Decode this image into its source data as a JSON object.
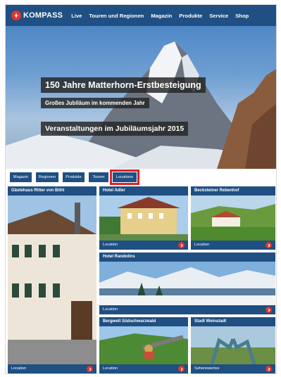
{
  "header": {
    "logo_text": "KOMPASS",
    "nav": [
      "Live",
      "Touren und Regionen",
      "Magazin",
      "Produkte",
      "Service",
      "Shop"
    ]
  },
  "hero": {
    "title": "150 Jahre Matterhorn-Erstbesteigung",
    "subtitle": "Großes Jubiläum im kommenden Jahr",
    "events": "Veranstaltungen im Jubiläumsjahr 2015"
  },
  "tabs": {
    "items": [
      "Magazin",
      "Regionen",
      "Produkte",
      "Touren",
      "Locations"
    ],
    "selected": "Locations"
  },
  "tiles": [
    {
      "title": "Gästehaus Ritter von Böhl",
      "footer": "Location"
    },
    {
      "title": "Hotel Adler",
      "footer": "Location"
    },
    {
      "title": "Becksteiner Rebenhof",
      "footer": "Location"
    },
    {
      "title": "Hotel Randolins",
      "footer": "Location"
    },
    {
      "title": "Bergwelt Südschwarzwald",
      "footer": "Location"
    },
    {
      "title": "Stadt Weinstadt",
      "footer": "Sehenswertes"
    }
  ],
  "colors": {
    "brand_blue": "#1f4f83",
    "accent_red": "#e2342b",
    "highlight_red": "#e3201f"
  },
  "icons": {
    "logo": "compass-logo-icon",
    "tile_button": "arrow-right-icon"
  }
}
